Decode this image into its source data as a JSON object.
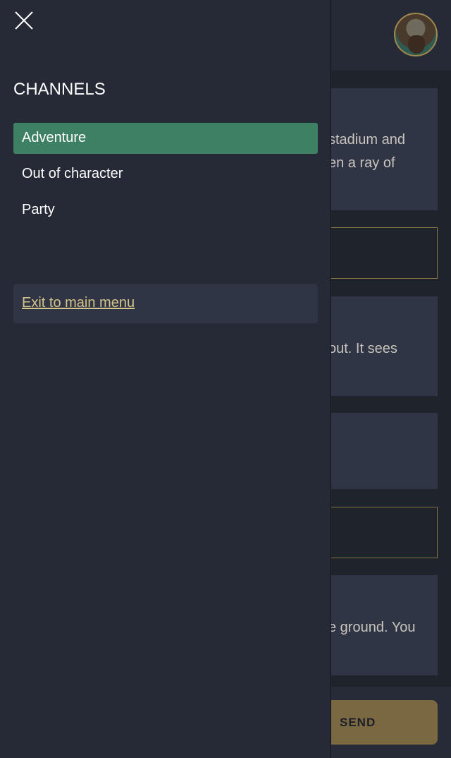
{
  "header": {
    "avatar": "dwarf-warrior-portrait"
  },
  "messages": [
    {
      "lines": [
        "stadium and",
        "en a ray of"
      ]
    },
    {
      "lines": []
    },
    {
      "lines": [
        "out. It sees"
      ]
    },
    {
      "lines": []
    },
    {
      "lines": []
    },
    {
      "lines": [
        "e ground. You"
      ]
    }
  ],
  "composer": {
    "send_label": "SEND"
  },
  "drawer": {
    "close_icon": "close-icon",
    "title": "CHANNELS",
    "channels": [
      {
        "label": "Adventure",
        "active": true
      },
      {
        "label": "Out of character"
      },
      {
        "label": "Party"
      }
    ],
    "exit_label": "Exit to main menu"
  },
  "colors": {
    "accent_green": "#3e8064",
    "gold": "#8b7440",
    "send": "#7a6841",
    "link": "#d6c38a"
  }
}
